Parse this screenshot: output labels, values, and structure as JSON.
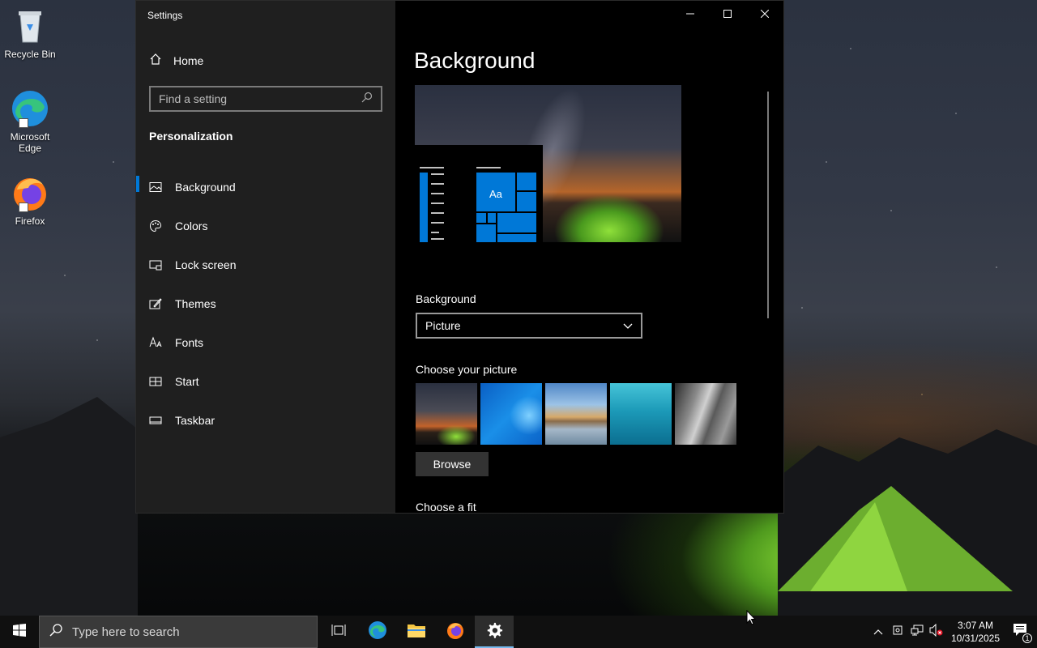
{
  "desktop": {
    "icons": [
      {
        "label": "Recycle Bin"
      },
      {
        "label": "Microsoft\nEdge"
      },
      {
        "label": "Firefox"
      }
    ]
  },
  "window": {
    "title": "Settings",
    "home_label": "Home",
    "search_placeholder": "Find a setting",
    "section_title": "Personalization",
    "nav": [
      {
        "label": "Background",
        "icon": "picture-icon",
        "active": true
      },
      {
        "label": "Colors",
        "icon": "palette-icon"
      },
      {
        "label": "Lock screen",
        "icon": "lock-screen-icon"
      },
      {
        "label": "Themes",
        "icon": "themes-icon"
      },
      {
        "label": "Fonts",
        "icon": "fonts-icon"
      },
      {
        "label": "Start",
        "icon": "start-icon"
      },
      {
        "label": "Taskbar",
        "icon": "taskbar-icon"
      }
    ]
  },
  "content": {
    "page_title": "Background",
    "preview_tile_text": "Aa",
    "background_label": "Background",
    "background_value": "Picture",
    "choose_picture_label": "Choose your picture",
    "browse_label": "Browse",
    "choose_fit_label": "Choose a fit"
  },
  "taskbar": {
    "search_placeholder": "Type here to search",
    "time": "3:07 AM",
    "date": "10/31/2025",
    "notification_count": "1"
  },
  "colors": {
    "accent": "#0078d7",
    "sidebar_bg": "#1f1f1f",
    "content_bg": "#000000",
    "taskbar_bg": "#101010"
  }
}
